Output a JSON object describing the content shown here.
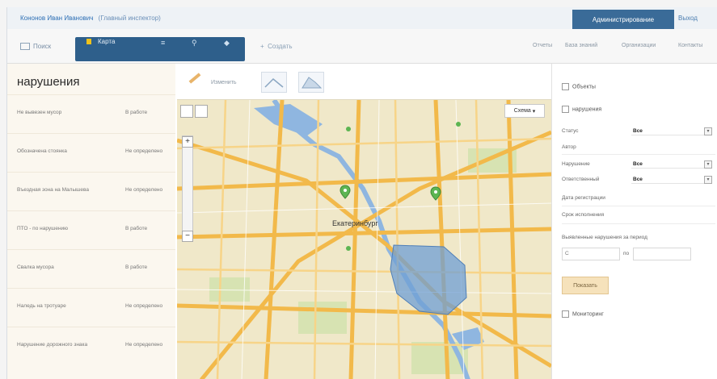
{
  "header": {
    "user_name": "Кононов Иван Иванович",
    "user_link": "(Главный инспектор)",
    "admin_button": "Администрирование",
    "exit_link": "Выход"
  },
  "toolbar": {
    "search_label": "Поиск",
    "map_label": "Карта",
    "create_label": "Создать",
    "nav": [
      "Отчеты",
      "База знаний",
      "Организации",
      "Контакты"
    ]
  },
  "left_panel": {
    "title": "нарушения",
    "rows": [
      {
        "name": "Не вывезен мусор",
        "status": "В работе"
      },
      {
        "name": "Обозначена стоянка",
        "status": "Не определено"
      },
      {
        "name": "Въездная зона на Малышева",
        "status": "Не определено"
      },
      {
        "name": "ПТО - по нарушению",
        "status": "В работе"
      },
      {
        "name": "Свалка мусора",
        "status": "В работе"
      },
      {
        "name": "Наледь на тротуаре",
        "status": "Не определено"
      },
      {
        "name": "Нарушение дорожного знака",
        "status": "Не определено"
      }
    ]
  },
  "map_tools": {
    "edit_label": "Изменить"
  },
  "map": {
    "scheme_label": "Схема",
    "city_label": "Екатеринбург",
    "colors": {
      "road": "#f2b94a",
      "water": "#7fa8d8",
      "park": "#cfe0a8",
      "region": "#6f9fd4"
    }
  },
  "right_panel": {
    "objects_label": "Объекты",
    "violations_label": "нарушения",
    "status_label": "Статус",
    "status_value": "Все",
    "author_label": "Автор",
    "violation_label": "Нарушение",
    "violation_value": "Все",
    "responsible_label": "Ответственный",
    "responsible_value": "Все",
    "reg_date_label": "Дата регистрации",
    "deadline_label": "Срок исполнения",
    "period_label": "Выявленные нарушения за период",
    "from_label": "С",
    "to_label": "по",
    "apply_button": "Показать",
    "monitoring_label": "Мониторинг"
  }
}
